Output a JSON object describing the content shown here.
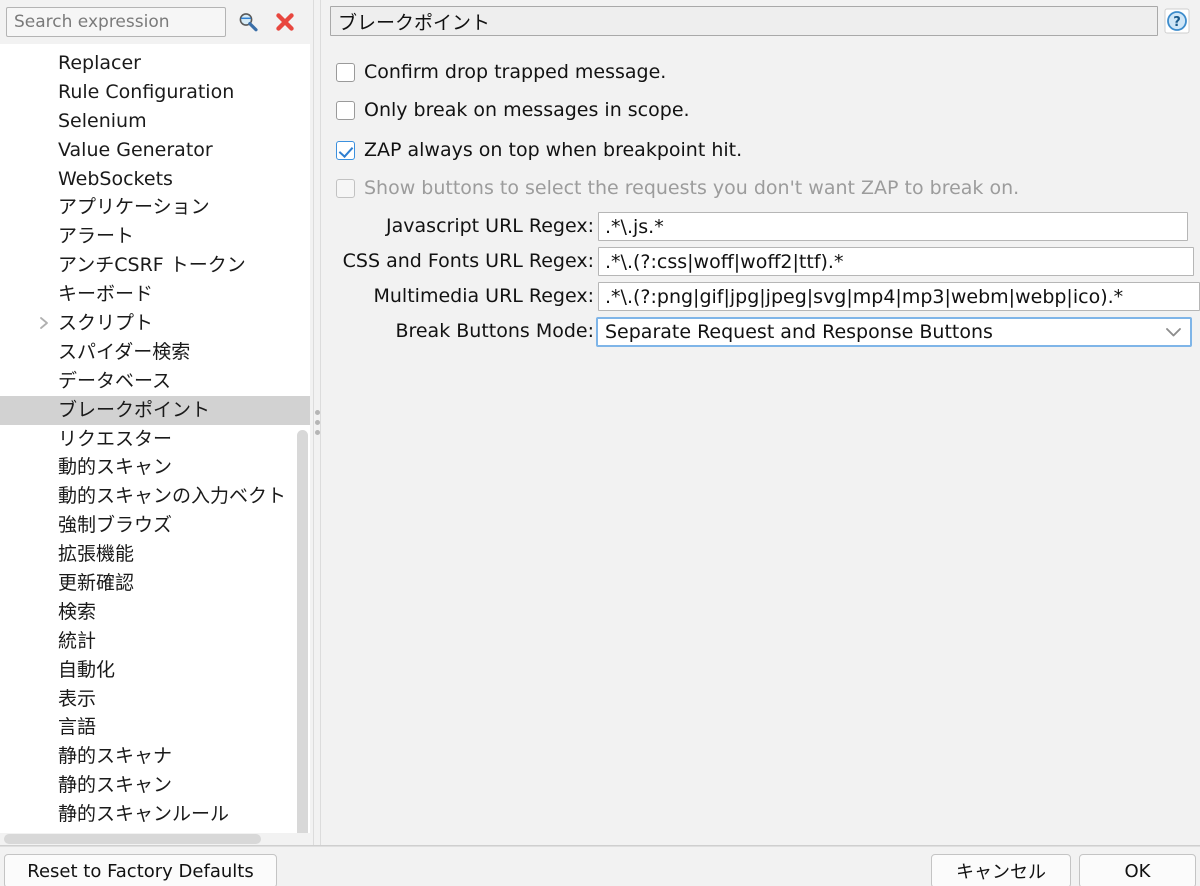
{
  "search": {
    "placeholder": "Search expression",
    "value": "",
    "search_icon": "search-icon",
    "clear_icon": "clear-x-icon"
  },
  "sidebar": {
    "items": [
      {
        "label": "Replacer",
        "expandable": false,
        "selected": false
      },
      {
        "label": "Rule Configuration",
        "expandable": false,
        "selected": false
      },
      {
        "label": "Selenium",
        "expandable": false,
        "selected": false
      },
      {
        "label": "Value Generator",
        "expandable": false,
        "selected": false
      },
      {
        "label": "WebSockets",
        "expandable": false,
        "selected": false
      },
      {
        "label": "アプリケーション",
        "expandable": false,
        "selected": false
      },
      {
        "label": "アラート",
        "expandable": false,
        "selected": false
      },
      {
        "label": "アンチCSRF トークン",
        "expandable": false,
        "selected": false
      },
      {
        "label": "キーボード",
        "expandable": false,
        "selected": false
      },
      {
        "label": "スクリプト",
        "expandable": true,
        "selected": false
      },
      {
        "label": "スパイダー検索",
        "expandable": false,
        "selected": false
      },
      {
        "label": "データベース",
        "expandable": false,
        "selected": false
      },
      {
        "label": "ブレークポイント",
        "expandable": false,
        "selected": true
      },
      {
        "label": "リクエスター",
        "expandable": false,
        "selected": false
      },
      {
        "label": "動的スキャン",
        "expandable": false,
        "selected": false
      },
      {
        "label": "動的スキャンの入力ベクト",
        "expandable": false,
        "selected": false
      },
      {
        "label": "強制ブラウズ",
        "expandable": false,
        "selected": false
      },
      {
        "label": "拡張機能",
        "expandable": false,
        "selected": false
      },
      {
        "label": "更新確認",
        "expandable": false,
        "selected": false
      },
      {
        "label": "検索",
        "expandable": false,
        "selected": false
      },
      {
        "label": "統計",
        "expandable": false,
        "selected": false
      },
      {
        "label": "自動化",
        "expandable": false,
        "selected": false
      },
      {
        "label": "表示",
        "expandable": false,
        "selected": false
      },
      {
        "label": "言語",
        "expandable": false,
        "selected": false
      },
      {
        "label": "静的スキャナ",
        "expandable": false,
        "selected": false
      },
      {
        "label": "静的スキャン",
        "expandable": false,
        "selected": false
      },
      {
        "label": "静的スキャンルール",
        "expandable": false,
        "selected": false
      }
    ]
  },
  "panel": {
    "title": "ブレークポイント",
    "help_icon": "help-question-icon",
    "checkboxes": [
      {
        "label": "Confirm drop trapped message.",
        "checked": false,
        "disabled": false
      },
      {
        "label": "Only break on messages in scope.",
        "checked": false,
        "disabled": false
      },
      {
        "label": "ZAP always on top when breakpoint hit.",
        "checked": true,
        "disabled": false
      },
      {
        "label": "Show buttons to select the requests you don't want ZAP to break on.",
        "checked": false,
        "disabled": true
      }
    ],
    "fields": [
      {
        "label": "Javascript URL Regex:",
        "value": ".*\\.js.*"
      },
      {
        "label": "CSS and Fonts URL Regex:",
        "value": ".*\\.(?:css|woff|woff2|ttf).*"
      },
      {
        "label": "Multimedia URL Regex:",
        "value": ".*\\.(?:png|gif|jpg|jpeg|svg|mp4|mp3|webm|webp|ico).*"
      }
    ],
    "combo": {
      "label": "Break Buttons Mode:",
      "value": "Separate Request and Response Buttons",
      "arrow_icon": "chevron-down-icon"
    }
  },
  "buttons": {
    "reset": "Reset to Factory Defaults",
    "cancel": "キャンセル",
    "ok": "OK"
  },
  "colors": {
    "accent_focus": "#7fb5e8",
    "checkbox_check": "#2f7fd1",
    "selection": "#d2d2d2",
    "clear_icon": "#e8473f",
    "help_icon": "#3d8ccc"
  }
}
